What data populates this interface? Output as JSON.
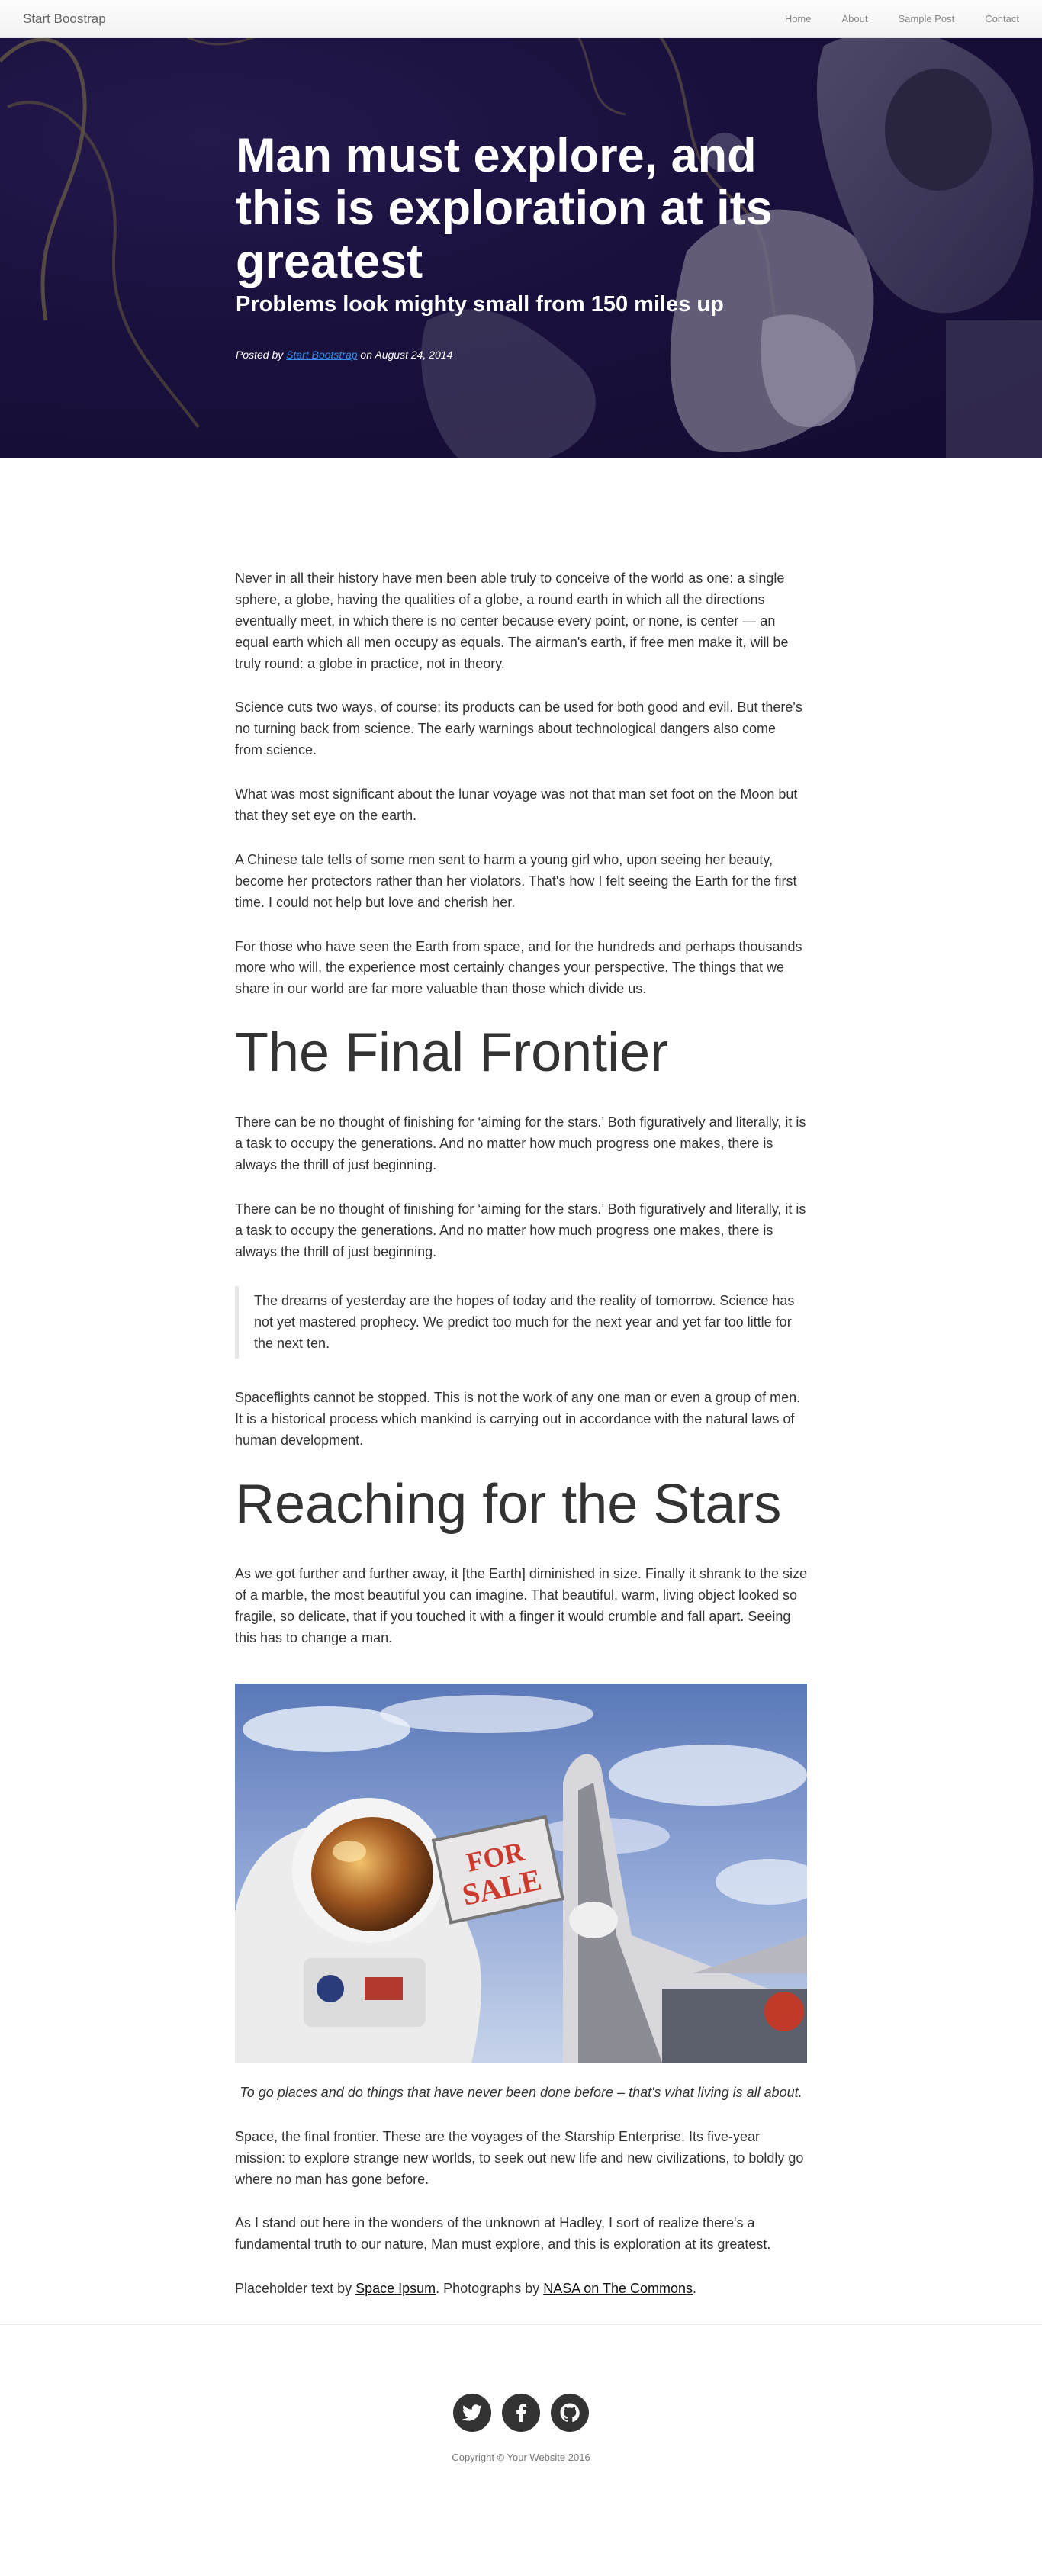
{
  "nav": {
    "brand": "Start Boostrap",
    "links": [
      "Home",
      "About",
      "Sample Post",
      "Contact"
    ]
  },
  "hero": {
    "title": "Man must explore, and this is exploration at its greatest",
    "subtitle": "Problems look mighty small from 150 miles up",
    "meta_prefix": "Posted by ",
    "meta_author": "Start Bootstrap",
    "meta_suffix": " on August 24, 2014"
  },
  "article": {
    "p1": "Never in all their history have men been able truly to conceive of the world as one: a single sphere, a globe, having the qualities of a globe, a round earth in which all the directions eventually meet, in which there is no center because every point, or none, is center — an equal earth which all men occupy as equals. The airman's earth, if free men make it, will be truly round: a globe in practice, not in theory.",
    "p2": "Science cuts two ways, of course; its products can be used for both good and evil. But there's no turning back from science. The early warnings about technological dangers also come from science.",
    "p3": "What was most significant about the lunar voyage was not that man set foot on the Moon but that they set eye on the earth.",
    "p4": "A Chinese tale tells of some men sent to harm a young girl who, upon seeing her beauty, become her protectors rather than her violators. That's how I felt seeing the Earth for the first time. I could not help but love and cherish her.",
    "p5": "For those who have seen the Earth from space, and for the hundreds and perhaps thousands more who will, the experience most certainly changes your perspective. The things that we share in our world are far more valuable than those which divide us.",
    "h1": "The Final Frontier",
    "p6": "There can be no thought of finishing for ‘aiming for the stars.’ Both figuratively and literally, it is a task to occupy the generations. And no matter how much progress one makes, there is always the thrill of just beginning.",
    "p7": "There can be no thought of finishing for ‘aiming for the stars.’ Both figuratively and literally, it is a task to occupy the generations. And no matter how much progress one makes, there is always the thrill of just beginning.",
    "quote": "The dreams of yesterday are the hopes of today and the reality of tomorrow. Science has not yet mastered prophecy. We predict too much for the next year and yet far too little for the next ten.",
    "p8": "Spaceflights cannot be stopped. This is not the work of any one man or even a group of men. It is a historical process which mankind is carrying out in accordance with the natural laws of human development.",
    "h2": "Reaching for the Stars",
    "p9": "As we got further and further away, it [the Earth] diminished in size. Finally it shrank to the size of a marble, the most beautiful you can imagine. That beautiful, warm, living object looked so fragile, so delicate, that if you touched it with a finger it would crumble and fall apart. Seeing this has to change a man.",
    "sign_text_1": "FOR",
    "sign_text_2": "SALE",
    "caption": "To go places and do things that have never been done before – that's what living is all about.",
    "p10": "Space, the final frontier. These are the voyages of the Starship Enterprise. Its five-year mission: to explore strange new worlds, to seek out new life and new civilizations, to boldly go where no man has gone before.",
    "p11": "As I stand out here in the wonders of the unknown at Hadley, I sort of realize there's a fundamental truth to our nature, Man must explore, and this is exploration at its greatest.",
    "credit_prefix": "Placeholder text by ",
    "credit_link1": "Space Ipsum",
    "credit_mid": ". Photographs by ",
    "credit_link2": "NASA on The Commons",
    "credit_suffix": "."
  },
  "footer": {
    "social": [
      "twitter-icon",
      "facebook-icon",
      "github-icon"
    ],
    "copyright": "Copyright © Your Website 2016"
  }
}
